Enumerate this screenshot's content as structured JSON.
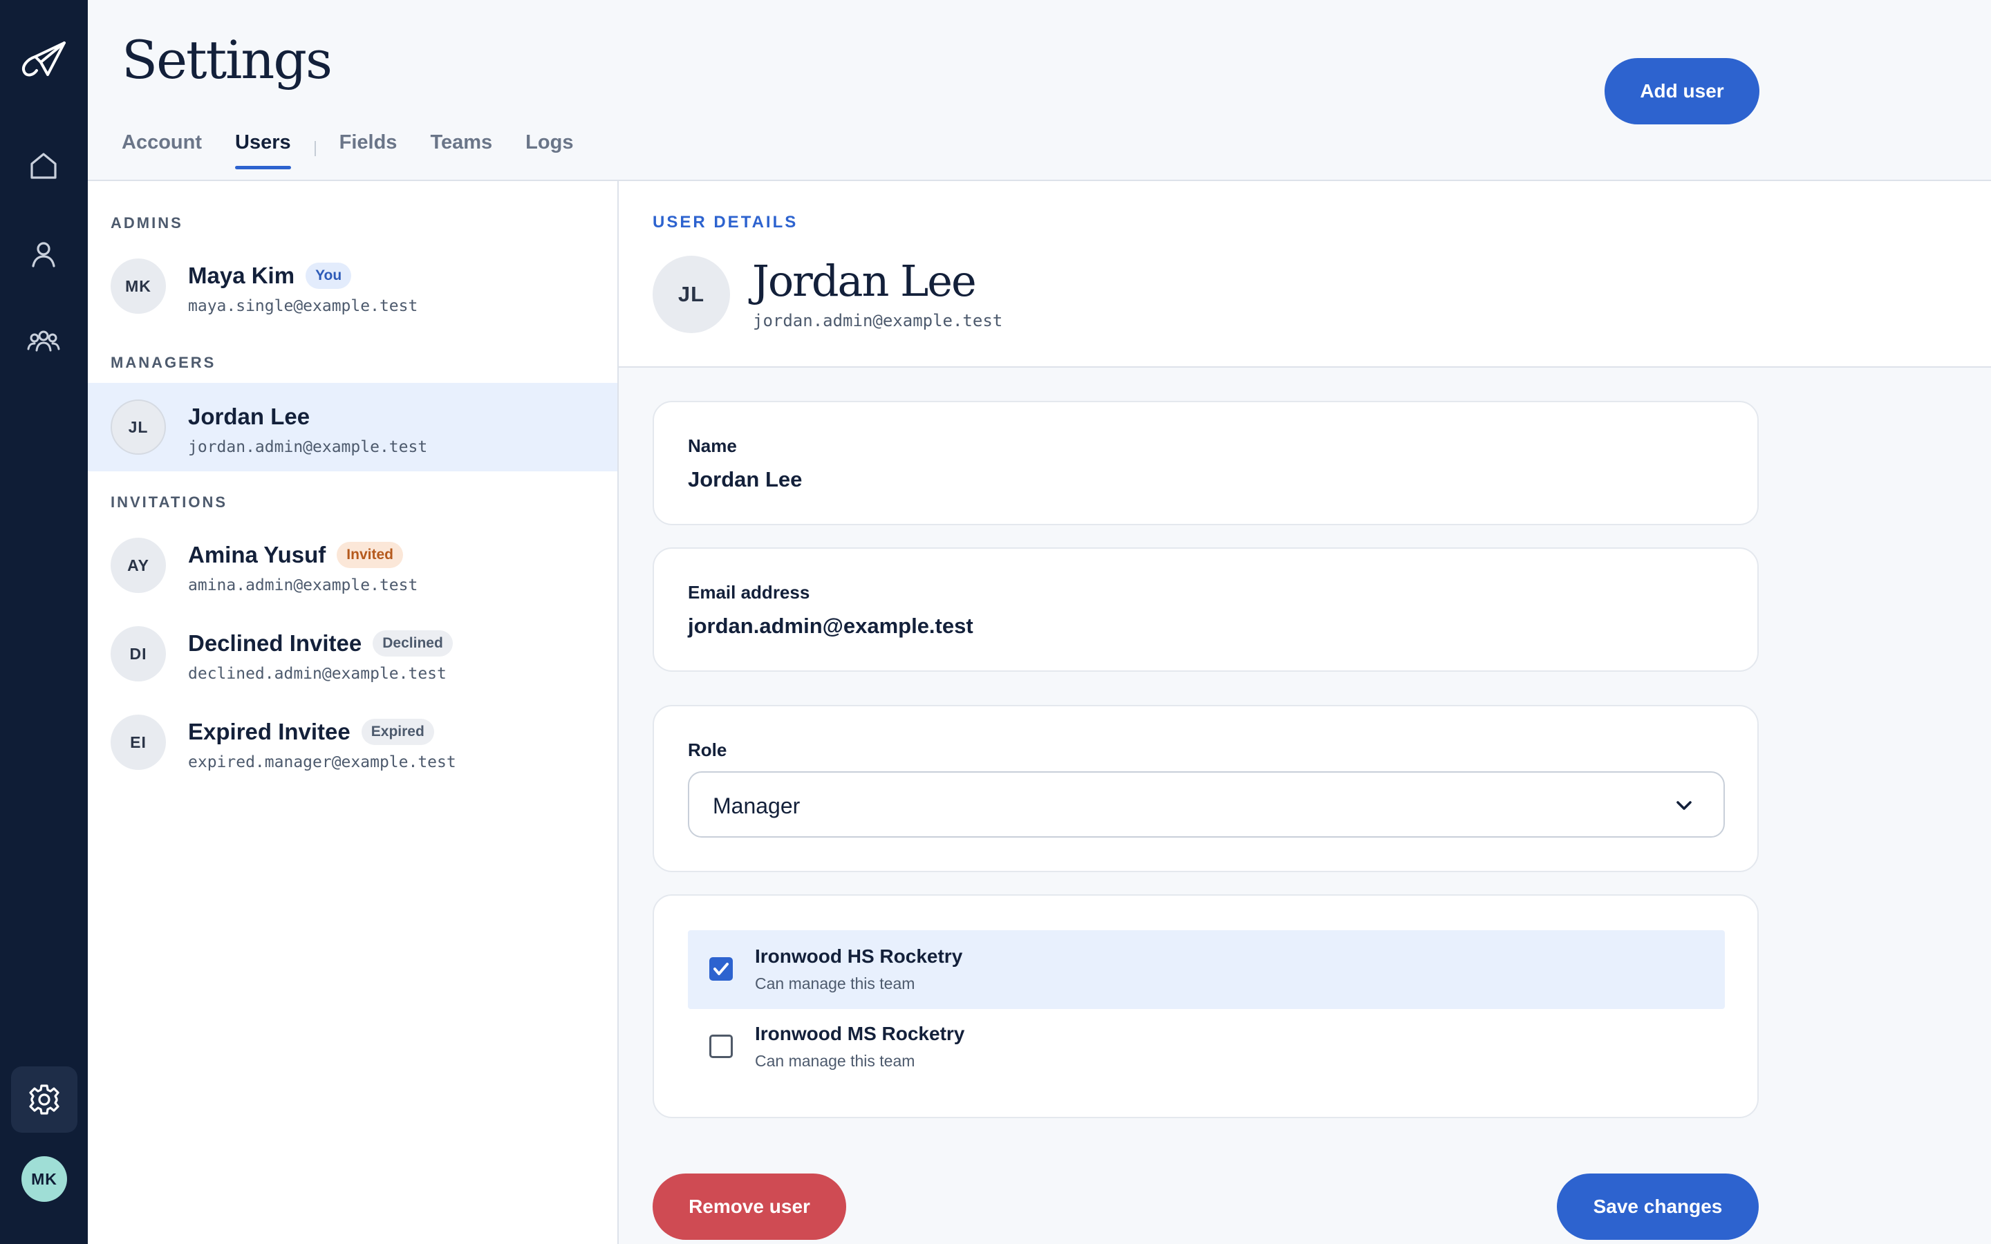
{
  "rail": {
    "icons": [
      "paper-plane-logo-icon",
      "home-icon",
      "user-icon",
      "users-group-icon",
      "gear-icon"
    ],
    "current_user_initials": "MK"
  },
  "header": {
    "title": "Settings",
    "tabs": [
      {
        "label": "Account",
        "active": false
      },
      {
        "label": "Users",
        "active": true
      },
      {
        "label": "Fields",
        "active": false
      },
      {
        "label": "Teams",
        "active": false
      },
      {
        "label": "Logs",
        "active": false
      }
    ],
    "add_user_label": "Add user"
  },
  "user_list": {
    "groups": [
      {
        "label": "ADMINS",
        "users": [
          {
            "initials": "MK",
            "name": "Maya Kim",
            "badge": "You",
            "email": "maya.single@example.test"
          }
        ]
      },
      {
        "label": "MANAGERS",
        "users": [
          {
            "initials": "JL",
            "name": "Jordan Lee",
            "email": "jordan.admin@example.test",
            "selected": true
          }
        ]
      },
      {
        "label": "INVITATIONS",
        "users": [
          {
            "initials": "AY",
            "name": "Amina Yusuf",
            "badge": "Invited",
            "email": "amina.admin@example.test"
          },
          {
            "initials": "DI",
            "name": "Declined Invitee",
            "badge": "Declined",
            "email": "declined.admin@example.test",
            "removable": true
          },
          {
            "initials": "EI",
            "name": "Expired Invitee",
            "badge": "Expired",
            "email": "expired.manager@example.test",
            "removable": true
          }
        ]
      }
    ]
  },
  "details": {
    "section_label": "USER DETAILS",
    "initials": "JL",
    "name": "Jordan Lee",
    "email": "jordan.admin@example.test",
    "name_field": {
      "label": "Name",
      "value": "Jordan Lee"
    },
    "email_field": {
      "label": "Email address",
      "value": "jordan.admin@example.test"
    },
    "role_field": {
      "label": "Role",
      "value": "Manager"
    },
    "teams": [
      {
        "name": "Ironwood HS Rocketry",
        "description": "Can manage this team",
        "checked": true
      },
      {
        "name": "Ironwood MS Rocketry",
        "description": "Can manage this team",
        "checked": false
      }
    ],
    "remove_label": "Remove user",
    "save_label": "Save changes"
  },
  "colors": {
    "rail": "#0f1d36",
    "accent": "#2d63cf",
    "danger": "#cf4b53",
    "selected_row": "#e8f0fd"
  }
}
